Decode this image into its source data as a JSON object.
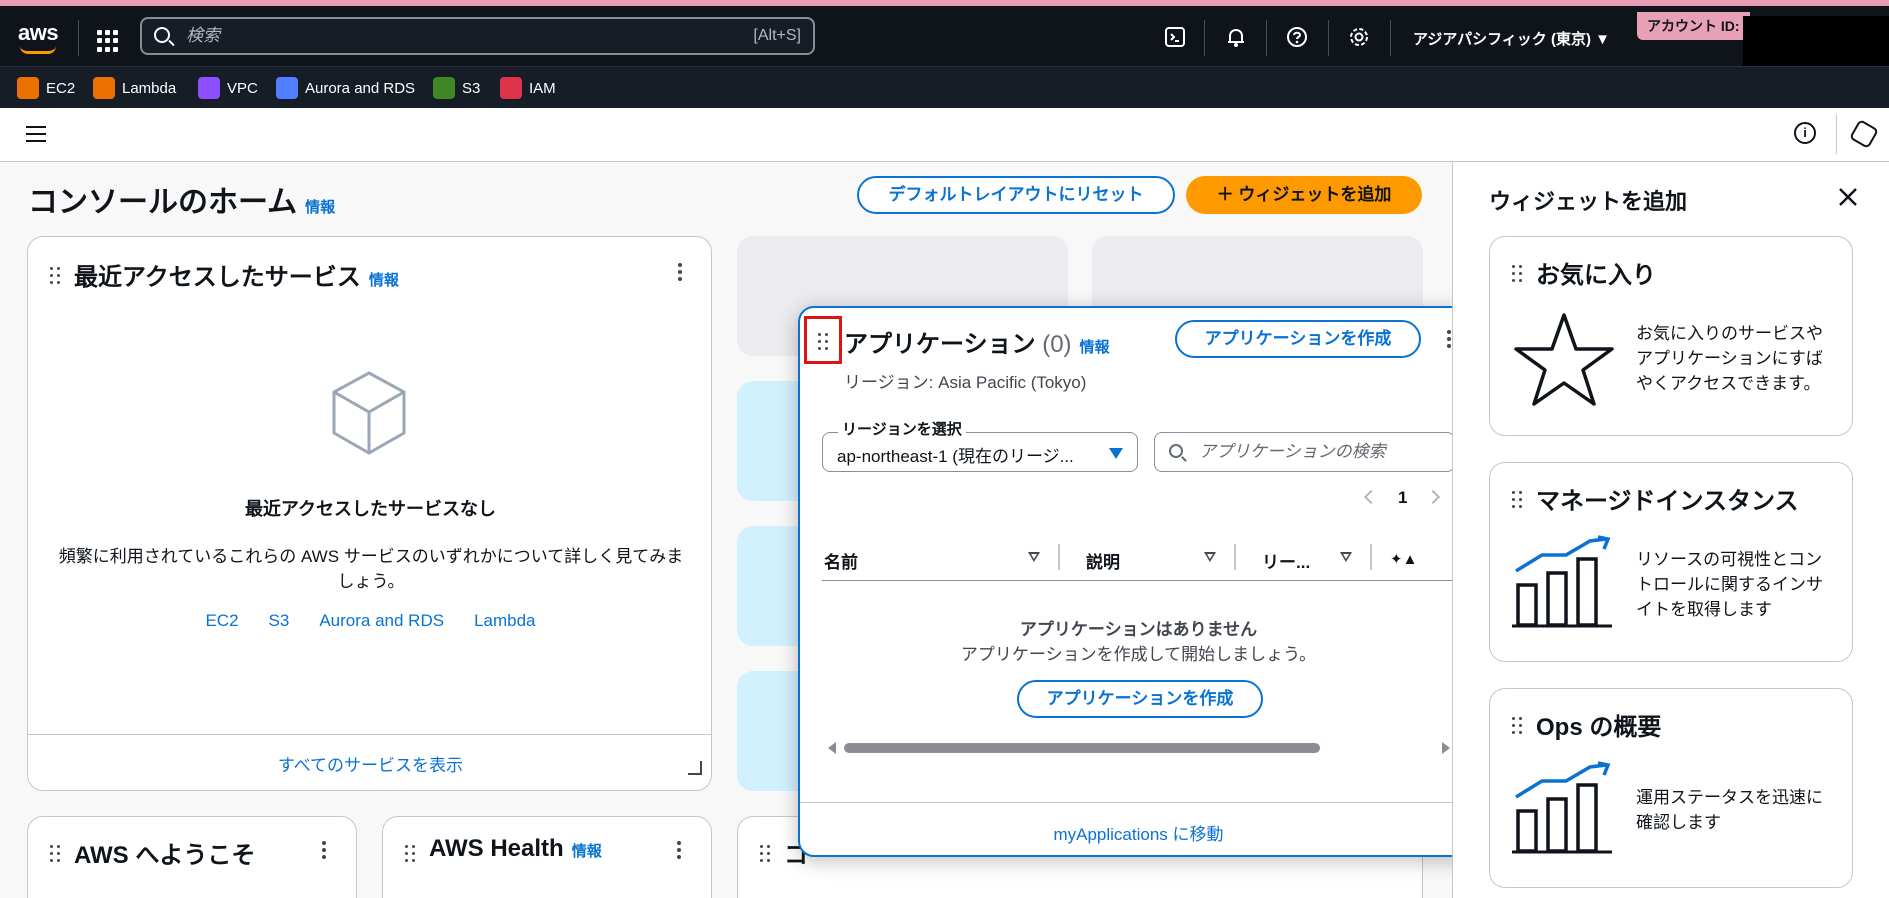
{
  "topbar": {
    "logo": "aws",
    "search_placeholder": "検索",
    "search_shortcut": "[Alt+S]",
    "region": "アジアパシフィック (東京) ▼",
    "account_label": "アカウント ID:",
    "icons": [
      "cloudshell-icon",
      "bell-icon",
      "help-icon",
      "gear-icon"
    ]
  },
  "favorites": [
    {
      "label": "EC2",
      "color": "#ed7100"
    },
    {
      "label": "Lambda",
      "color": "#ed7100"
    },
    {
      "label": "VPC",
      "color": "#8c4fff"
    },
    {
      "label": "Aurora and RDS",
      "color": "#527fff"
    },
    {
      "label": "S3",
      "color": "#3f8624"
    },
    {
      "label": "IAM",
      "color": "#dd344c"
    }
  ],
  "page": {
    "title": "コンソールのホーム",
    "info": "情報",
    "reset_button": "デフォルトレイアウトにリセット",
    "add_widget_button": "＋ ウィジェットを追加"
  },
  "recent": {
    "title": "最近アクセスしたサービス",
    "info": "情報",
    "empty_title": "最近アクセスしたサービスなし",
    "empty_desc": "頻繁に利用されているこれらの AWS サービスのいずれかについて詳しく見てみましょう。",
    "links": [
      "EC2",
      "S3",
      "Aurora and RDS",
      "Lambda"
    ],
    "footer": "すべてのサービスを表示"
  },
  "bottom_cards": {
    "welcome": "AWS へようこそ",
    "health": "AWS Health",
    "health_info": "情報",
    "partial": "コ"
  },
  "applications": {
    "title": "アプリケーション",
    "count": "(0)",
    "info": "情報",
    "create_button": "アプリケーションを作成",
    "region_line": "リージョン: Asia Pacific (Tokyo)",
    "region_select_label": "リージョンを選択",
    "region_value": "ap-northeast-1 (現在のリージ...",
    "search_placeholder": "アプリケーションの検索",
    "page_number": "1",
    "columns": [
      "名前",
      "説明",
      "リー..."
    ],
    "empty_title": "アプリケーションはありません",
    "empty_desc": "アプリケーションを作成して開始しましょう。",
    "empty_create": "アプリケーションを作成",
    "footer": "myApplications に移動"
  },
  "add_widget_panel": {
    "title": "ウィジェットを追加",
    "widgets": [
      {
        "title": "お気に入り",
        "desc": "お気に入りのサービスやアプリケーションにすばやくアクセスできます。"
      },
      {
        "title": "マネージドインスタンス",
        "desc": "リソースの可視性とコントロールに関するインサイトを取得します"
      },
      {
        "title": "Ops の概要",
        "desc": "運用ステータスを迅速に確認します"
      }
    ]
  }
}
